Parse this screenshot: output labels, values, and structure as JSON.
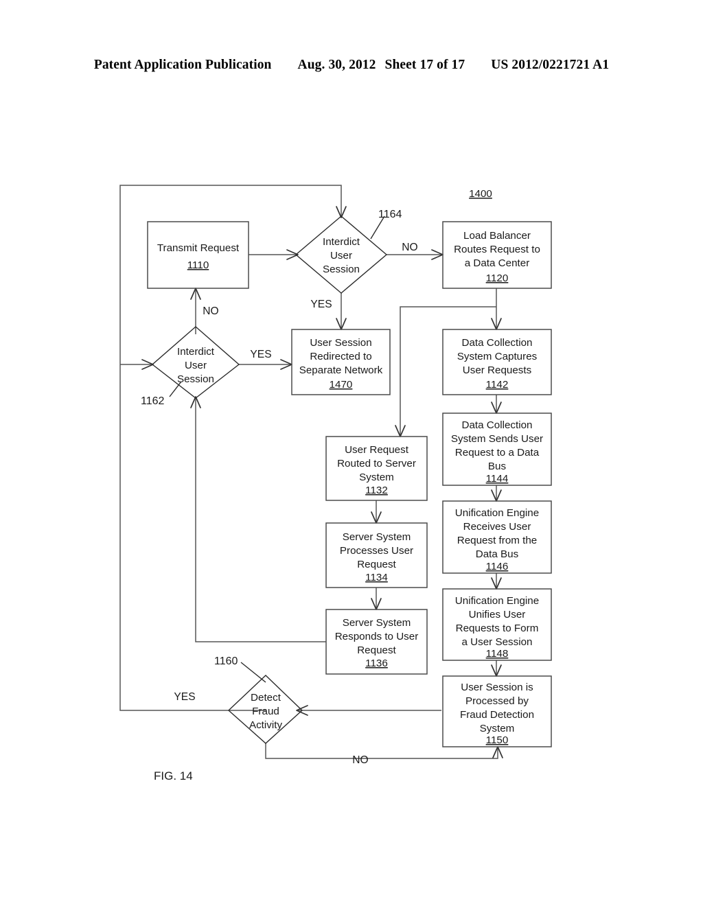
{
  "header": {
    "publication": "Patent Application Publication",
    "date": "Aug. 30, 2012",
    "sheet": "Sheet 17 of 17",
    "patent_number": "US 2012/0221721 A1"
  },
  "figure": {
    "caption": "FIG. 14",
    "diagram_number": "1400"
  },
  "nodes": {
    "transmit_request": {
      "lines": [
        "Transmit Request"
      ],
      "ref": "1110"
    },
    "interdict_top": {
      "lines": [
        "Interdict",
        "User",
        "Session"
      ],
      "ref": "1164"
    },
    "load_balancer": {
      "lines": [
        "Load Balancer",
        "Routes Request to",
        "a Data Center"
      ],
      "ref": "1120"
    },
    "interdict_left": {
      "lines": [
        "Interdict",
        "User",
        "Session"
      ],
      "ref": "1162"
    },
    "redirect_separate_network": {
      "lines": [
        "User Session",
        "Redirected to",
        "Separate Network"
      ],
      "ref": "1470"
    },
    "data_collection_captures": {
      "lines": [
        "Data Collection",
        "System Captures",
        "User Requests"
      ],
      "ref": "1142"
    },
    "data_collection_sends": {
      "lines": [
        "Data Collection",
        "System Sends User",
        "Request to a Data",
        "Bus"
      ],
      "ref": "1144"
    },
    "user_request_routed": {
      "lines": [
        "User Request",
        "Routed to Server",
        "System"
      ],
      "ref": "1132"
    },
    "unification_receives": {
      "lines": [
        "Unification Engine",
        "Receives User",
        "Request from the",
        "Data Bus"
      ],
      "ref": "1146"
    },
    "server_processes": {
      "lines": [
        "Server System",
        "Processes User",
        "Request"
      ],
      "ref": "1134"
    },
    "unification_unifies": {
      "lines": [
        "Unification Engine",
        "Unifies User",
        "Requests  to Form",
        "a User Session"
      ],
      "ref": "1148"
    },
    "server_responds": {
      "lines": [
        "Server System",
        "Responds to User",
        "Request"
      ],
      "ref": "1136"
    },
    "fraud_processed": {
      "lines": [
        "User Session is",
        "Processed by",
        "Fraud Detection",
        "System"
      ],
      "ref": "1150"
    },
    "detect_fraud": {
      "lines": [
        "Detect",
        "Fraud",
        "Activity"
      ],
      "ref": "1160"
    }
  },
  "edge_labels": {
    "interdict_top_no": "NO",
    "interdict_top_yes": "YES",
    "interdict_left_no": "NO",
    "interdict_left_yes": "YES",
    "detect_fraud_yes": "YES",
    "detect_fraud_no": "NO"
  }
}
